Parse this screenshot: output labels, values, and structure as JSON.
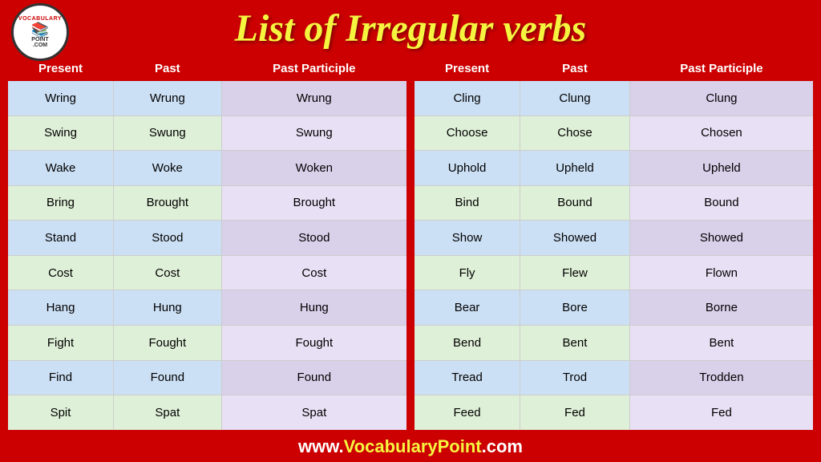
{
  "header": {
    "title": "List of Irregular verbs",
    "logo": {
      "top": "VOCABULARY",
      "bottom": "POINT\n.COM",
      "icon": "📚"
    }
  },
  "table_headers": {
    "present": "Present",
    "past": "Past",
    "past_participle": "Past Participle"
  },
  "left_table": [
    {
      "present": "Wring",
      "past": "Wrung",
      "pp": "Wrung"
    },
    {
      "present": "Swing",
      "past": "Swung",
      "pp": "Swung"
    },
    {
      "present": "Wake",
      "past": "Woke",
      "pp": "Woken"
    },
    {
      "present": "Bring",
      "past": "Brought",
      "pp": "Brought"
    },
    {
      "present": "Stand",
      "past": "Stood",
      "pp": "Stood"
    },
    {
      "present": "Cost",
      "past": "Cost",
      "pp": "Cost"
    },
    {
      "present": "Hang",
      "past": "Hung",
      "pp": "Hung"
    },
    {
      "present": "Fight",
      "past": "Fought",
      "pp": "Fought"
    },
    {
      "present": "Find",
      "past": "Found",
      "pp": "Found"
    },
    {
      "present": "Spit",
      "past": "Spat",
      "pp": "Spat"
    }
  ],
  "right_table": [
    {
      "present": "Cling",
      "past": "Clung",
      "pp": "Clung"
    },
    {
      "present": "Choose",
      "past": "Chose",
      "pp": "Chosen"
    },
    {
      "present": "Uphold",
      "past": "Upheld",
      "pp": "Upheld"
    },
    {
      "present": "Bind",
      "past": "Bound",
      "pp": "Bound"
    },
    {
      "present": "Show",
      "past": "Showed",
      "pp": "Showed"
    },
    {
      "present": "Fly",
      "past": "Flew",
      "pp": "Flown"
    },
    {
      "present": "Bear",
      "past": "Bore",
      "pp": "Borne"
    },
    {
      "present": "Bend",
      "past": "Bent",
      "pp": "Bent"
    },
    {
      "present": "Tread",
      "past": "Trod",
      "pp": "Trodden"
    },
    {
      "present": "Feed",
      "past": "Fed",
      "pp": "Fed"
    }
  ],
  "footer": {
    "text": "www.",
    "highlight": "VocabularyPoint",
    "text2": ".com"
  }
}
